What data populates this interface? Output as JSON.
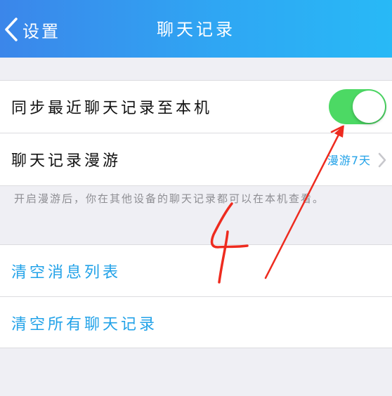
{
  "colors": {
    "nav_gradient_start": "#3b86ea",
    "nav_gradient_end": "#28b9f6",
    "toggle_on": "#4cd964",
    "link": "#22a2e8",
    "annotation": "#ee2b1f"
  },
  "navbar": {
    "back_label": "设置",
    "back_icon": "chevron-left-icon",
    "title": "聊天记录"
  },
  "sync_section": {
    "sync_label": "同步最近聊天记录至本机",
    "sync_enabled": true,
    "roaming_label": "聊天记录漫游",
    "roaming_value": "漫游7天",
    "roaming_icon": "chevron-right-icon",
    "footnote": "开启漫游后，你在其他设备的聊天记录都可以在本机查看。"
  },
  "clear_section": {
    "clear_messages_label": "清空消息列表",
    "clear_all_label": "清空所有聊天记录"
  },
  "annotation": {
    "number": "4"
  }
}
